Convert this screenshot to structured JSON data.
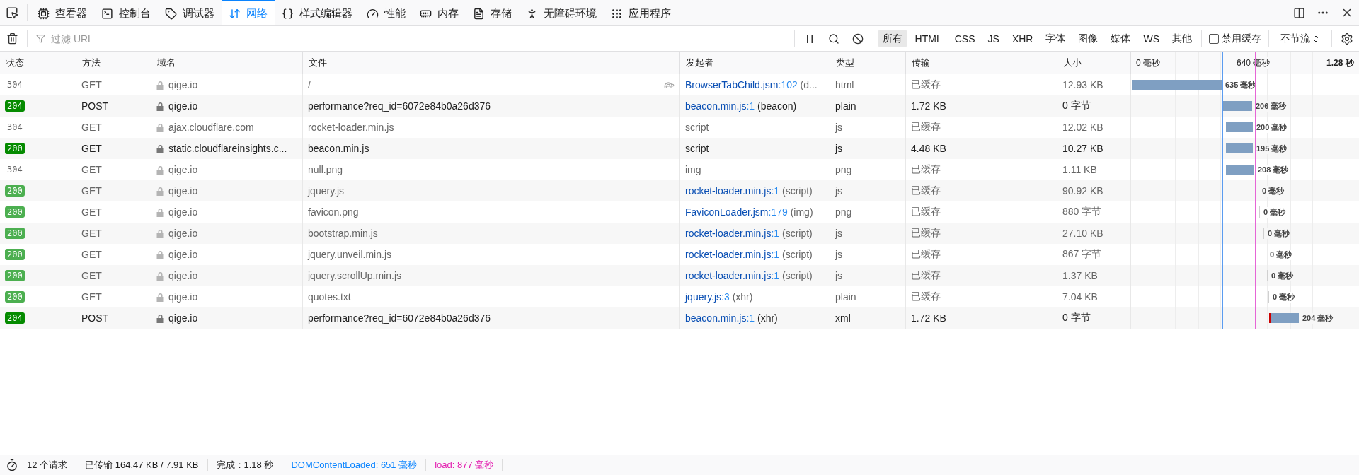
{
  "toolbar": {
    "tabs": [
      {
        "label": "查看器",
        "selected": false
      },
      {
        "label": "控制台",
        "selected": false
      },
      {
        "label": "调试器",
        "selected": false
      },
      {
        "label": "网络",
        "selected": true
      },
      {
        "label": "样式编辑器",
        "selected": false
      },
      {
        "label": "性能",
        "selected": false
      },
      {
        "label": "内存",
        "selected": false
      },
      {
        "label": "存储",
        "selected": false
      },
      {
        "label": "无障碍环境",
        "selected": false
      },
      {
        "label": "应用程序",
        "selected": false
      }
    ]
  },
  "filter_bar": {
    "search": {
      "placeholder": "过滤 URL"
    },
    "types": [
      {
        "label": "所有",
        "selected": true
      },
      {
        "label": "HTML",
        "selected": false
      },
      {
        "label": "CSS",
        "selected": false
      },
      {
        "label": "JS",
        "selected": false
      },
      {
        "label": "XHR",
        "selected": false
      },
      {
        "label": "字体",
        "selected": false
      },
      {
        "label": "图像",
        "selected": false
      },
      {
        "label": "媒体",
        "selected": false
      },
      {
        "label": "WS",
        "selected": false
      },
      {
        "label": "其他",
        "selected": false
      }
    ],
    "disable_cache": {
      "label": "禁用缓存",
      "checked": false
    },
    "throttle": "不节流"
  },
  "table": {
    "columns": [
      "状态",
      "方法",
      "域名",
      "文件",
      "发起者",
      "类型",
      "传输",
      "大小"
    ],
    "timeline_ticks": [
      {
        "label": "0 毫秒",
        "bold": false
      },
      {
        "label": "640 毫秒",
        "bold": false
      },
      {
        "label": "1.28 秒",
        "bold": true
      }
    ],
    "rows": [
      {
        "status": "304",
        "kind": "plain",
        "cached": true,
        "method": "GET",
        "domain": "qige.io",
        "file": "/",
        "slow": true,
        "initiator": {
          "link": "BrowserTabChild.jsm",
          "line": ":102",
          "cause": " (d..."
        },
        "type": "html",
        "transferred": "已缓存",
        "size": "12.93 KB",
        "time": "635 毫秒"
      },
      {
        "status": "204",
        "kind": "badge",
        "cached": false,
        "method": "POST",
        "domain": "qige.io",
        "file": "performance?req_id=6072e84b0a26d376",
        "slow": false,
        "initiator": {
          "link": "beacon.min.js",
          "line": ":1",
          "cause": " (beacon)"
        },
        "type": "plain",
        "transferred": "1.72 KB",
        "size": "0 字节",
        "time": "206 毫秒"
      },
      {
        "status": "304",
        "kind": "plain",
        "cached": true,
        "method": "GET",
        "domain": "ajax.cloudflare.com",
        "file": "rocket-loader.min.js",
        "slow": false,
        "initiator": {
          "text": "script"
        },
        "type": "js",
        "transferred": "已缓存",
        "size": "12.02 KB",
        "time": "200 毫秒"
      },
      {
        "status": "200",
        "kind": "badge",
        "cached": false,
        "method": "GET",
        "domain": "static.cloudflareinsights.c...",
        "file": "beacon.min.js",
        "slow": false,
        "initiator": {
          "text": "script"
        },
        "type": "js",
        "transferred": "4.48 KB",
        "size": "10.27 KB",
        "time": "195 毫秒"
      },
      {
        "status": "304",
        "kind": "plain",
        "cached": true,
        "method": "GET",
        "domain": "qige.io",
        "file": "null.png",
        "slow": false,
        "initiator": {
          "text": "img"
        },
        "type": "png",
        "transferred": "已缓存",
        "size": "1.11 KB",
        "time": "208 毫秒"
      },
      {
        "status": "200",
        "kind": "badge",
        "cached": true,
        "method": "GET",
        "domain": "qige.io",
        "file": "jquery.js",
        "slow": false,
        "initiator": {
          "link": "rocket-loader.min.js",
          "line": ":1",
          "cause": " (script)"
        },
        "type": "js",
        "transferred": "已缓存",
        "size": "90.92 KB",
        "time": "0 毫秒"
      },
      {
        "status": "200",
        "kind": "badge",
        "cached": true,
        "method": "GET",
        "domain": "qige.io",
        "file": "favicon.png",
        "slow": false,
        "initiator": {
          "link": "FaviconLoader.jsm",
          "line": ":179",
          "cause": " (img)"
        },
        "type": "png",
        "transferred": "已缓存",
        "size": "880 字节",
        "time": "0 毫秒"
      },
      {
        "status": "200",
        "kind": "badge",
        "cached": true,
        "method": "GET",
        "domain": "qige.io",
        "file": "bootstrap.min.js",
        "slow": false,
        "initiator": {
          "link": "rocket-loader.min.js",
          "line": ":1",
          "cause": " (script)"
        },
        "type": "js",
        "transferred": "已缓存",
        "size": "27.10 KB",
        "time": "0 毫秒"
      },
      {
        "status": "200",
        "kind": "badge",
        "cached": true,
        "method": "GET",
        "domain": "qige.io",
        "file": "jquery.unveil.min.js",
        "slow": false,
        "initiator": {
          "link": "rocket-loader.min.js",
          "line": ":1",
          "cause": " (script)"
        },
        "type": "js",
        "transferred": "已缓存",
        "size": "867 字节",
        "time": "0 毫秒"
      },
      {
        "status": "200",
        "kind": "badge",
        "cached": true,
        "method": "GET",
        "domain": "qige.io",
        "file": "jquery.scrollUp.min.js",
        "slow": false,
        "initiator": {
          "link": "rocket-loader.min.js",
          "line": ":1",
          "cause": " (script)"
        },
        "type": "js",
        "transferred": "已缓存",
        "size": "1.37 KB",
        "time": "0 毫秒"
      },
      {
        "status": "200",
        "kind": "badge",
        "cached": true,
        "method": "GET",
        "domain": "qige.io",
        "file": "quotes.txt",
        "slow": false,
        "initiator": {
          "link": "jquery.js",
          "line": ":3",
          "cause": " (xhr)"
        },
        "type": "plain",
        "transferred": "已缓存",
        "size": "7.04 KB",
        "time": "0 毫秒"
      },
      {
        "status": "204",
        "kind": "badge",
        "cached": false,
        "method": "POST",
        "domain": "qige.io",
        "file": "performance?req_id=6072e84b0a26d376",
        "slow": false,
        "initiator": {
          "link": "beacon.min.js",
          "line": ":1",
          "cause": " (xhr)"
        },
        "type": "xml",
        "transferred": "1.72 KB",
        "size": "0 字节",
        "time": "204 毫秒"
      }
    ]
  },
  "status_bar": [
    {
      "kind": "plain",
      "text": "12 个请求"
    },
    {
      "kind": "plain",
      "text": "已传输 164.47 KB / 7.91 KB"
    },
    {
      "kind": "plain",
      "text": "完成：1.18 秒"
    },
    {
      "kind": "dom",
      "text": "DOMContentLoaded: 651 毫秒"
    },
    {
      "kind": "load",
      "text": "load: 877 毫秒"
    }
  ]
}
